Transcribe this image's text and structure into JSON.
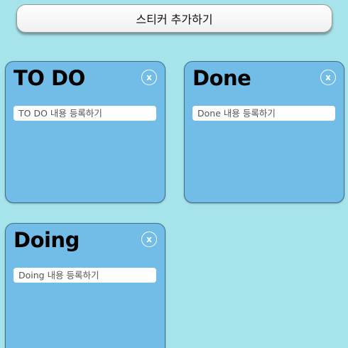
{
  "toolbar": {
    "add_sticker_label": "스티커 추가하기"
  },
  "stickers": [
    {
      "title": "TO DO",
      "placeholder": "TO DO 내용 등록하기",
      "close_label": "x"
    },
    {
      "title": "Done",
      "placeholder": "Done 내용 등록하기",
      "close_label": "x"
    },
    {
      "title": "Doing",
      "placeholder": "Doing 내용 등록하기",
      "close_label": "x"
    }
  ],
  "colors": {
    "background": "#a7e3ea",
    "sticker": "#71bde8",
    "sticker_border": "#3f6f8a"
  }
}
